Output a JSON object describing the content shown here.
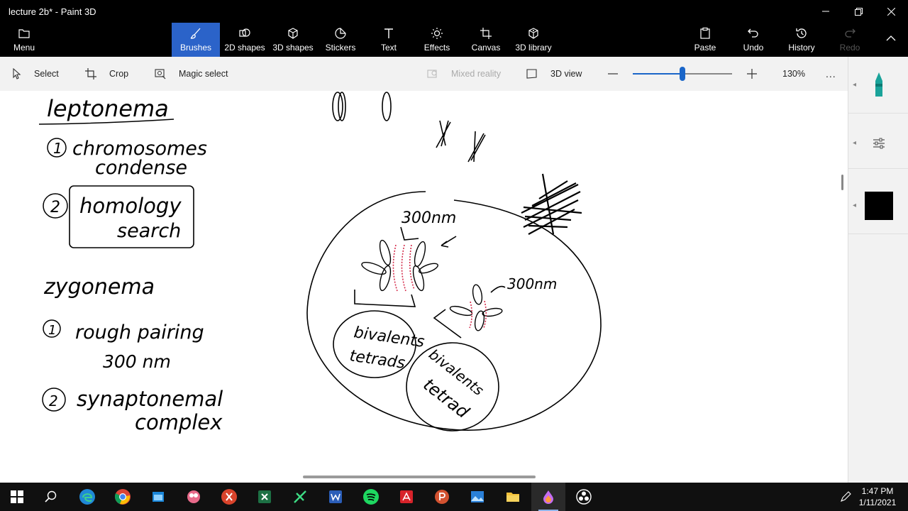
{
  "window": {
    "title": "lecture 2b* - Paint 3D",
    "controls": [
      "minimize",
      "restore",
      "close"
    ]
  },
  "ribbon": {
    "menu": "Menu",
    "tools": [
      {
        "id": "brushes",
        "label": "Brushes",
        "icon": "brush-icon",
        "active": true
      },
      {
        "id": "2d-shapes",
        "label": "2D shapes",
        "icon": "2d-shapes-icon"
      },
      {
        "id": "3d-shapes",
        "label": "3D shapes",
        "icon": "cube-icon"
      },
      {
        "id": "stickers",
        "label": "Stickers",
        "icon": "sticker-icon"
      },
      {
        "id": "text",
        "label": "Text",
        "icon": "text-icon"
      },
      {
        "id": "effects",
        "label": "Effects",
        "icon": "sun-icon"
      },
      {
        "id": "canvas",
        "label": "Canvas",
        "icon": "canvas-icon"
      },
      {
        "id": "3d-library",
        "label": "3D library",
        "icon": "library-icon"
      }
    ],
    "paste": "Paste",
    "undo": "Undo",
    "history": "History",
    "redo": "Redo"
  },
  "toolbar": {
    "select": "Select",
    "crop": "Crop",
    "magic_select": "Magic select",
    "mixed_reality": "Mixed reality",
    "view_3d": "3D view",
    "zoom_percent": "130%",
    "zoom_level": 0.5,
    "more": "..."
  },
  "canvas": {
    "handwriting": {
      "leptonema": "leptonema",
      "item1_num": "1",
      "item1": "chromosomes",
      "item1b": "condense",
      "item2_num": "2",
      "item2": "homology",
      "item2b": "search",
      "zygonema": "zygonema",
      "z1_num": "1",
      "z1": "rough pairing",
      "z1b": "300 nm",
      "z2_num": "2",
      "z2": "synaptonemal",
      "z2b": "complex",
      "label_300a": "300nm",
      "label_300b": "300nm",
      "bivalents_a": "bivalents",
      "tetrads_a": "tetrads",
      "bivalents_b": "bivalents",
      "tetrad_b": "tetrad"
    }
  },
  "sidepanel": {
    "brush_icon": "marker-icon",
    "settings_icon": "sliders-icon",
    "color": "#000000"
  },
  "taskbar": {
    "apps": [
      "windows-start-icon",
      "search-icon",
      "edge-icon",
      "chrome-icon",
      "file-app-icon",
      "snipping-icon",
      "app-red-icon",
      "excel-icon",
      "tool-icon",
      "word-icon",
      "spotify-icon",
      "acrobat-icon",
      "powerpoint-icon",
      "photos-icon",
      "file-explorer-icon",
      "paint3d-icon",
      "obs-icon"
    ],
    "time": "1:47 PM",
    "date": "1/11/2021"
  }
}
